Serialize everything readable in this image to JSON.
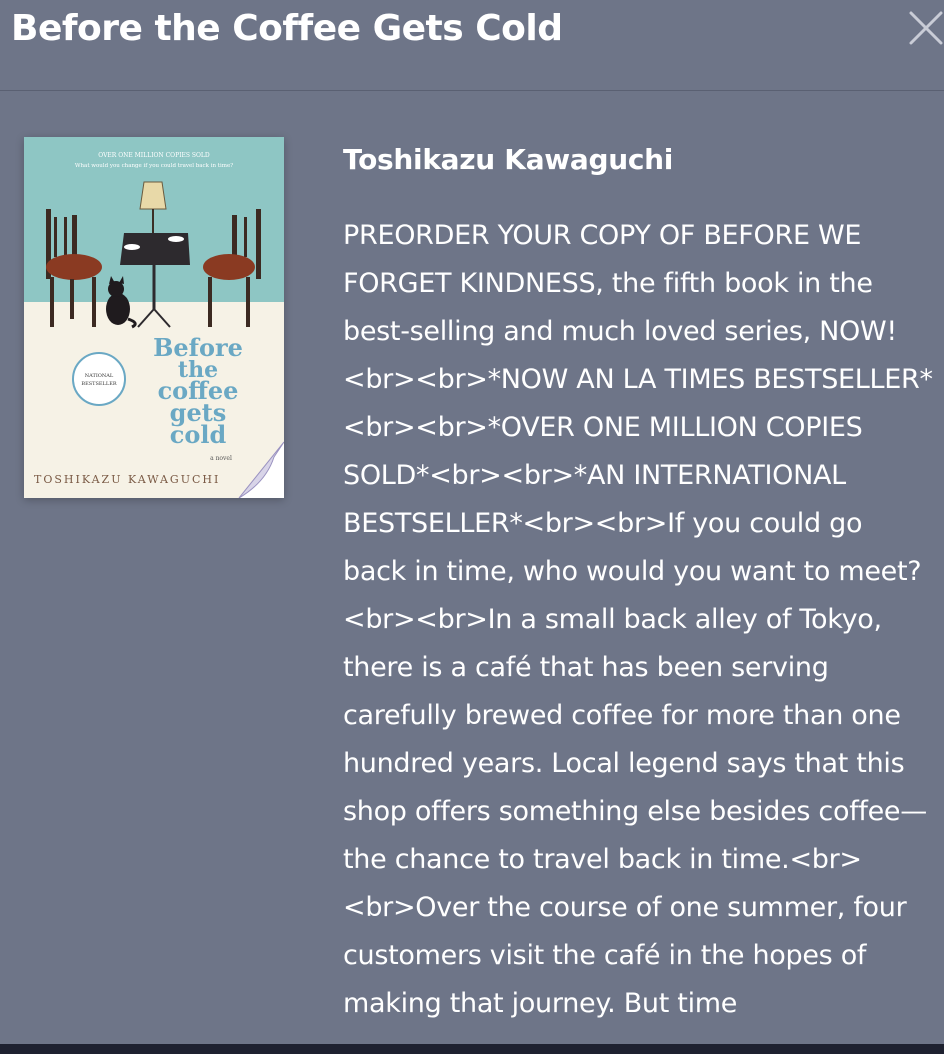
{
  "modal": {
    "title": "Before the Coffee Gets Cold",
    "close_icon": "close-icon",
    "author": "Toshikazu Kawaguchi",
    "description": "PREORDER YOUR COPY OF BEFORE WE FORGET KINDNESS, the fifth book in the best-selling and much loved series, NOW!<br><br>*NOW AN LA TIMES BESTSELLER*<br><br>*OVER ONE MILLION COPIES SOLD*<br><br>*AN INTERNATIONAL BESTSELLER*<br><br>If you could go back in time, who would you want to meet?<br><br>In a small back alley of Tokyo, there is a café that has been serving carefully brewed coffee for more than one hundred years. Local legend says that this shop offers something else besides coffee—the chance to travel back in time.<br><br>Over the course of one summer, four customers visit the café in the hopes of making that journey. But time"
  },
  "cover": {
    "top_banner": "OVER ONE MILLION COPIES SOLD",
    "tagline": "What would you change if you could travel back in time?",
    "badge_line1": "NATIONAL",
    "badge_line2": "BESTSELLER",
    "title_line1": "Before",
    "title_line2": "the",
    "title_line3": "coffee",
    "title_line4": "gets",
    "title_line5": "cold",
    "subtitle": "a novel",
    "author": "TOSHIKAZU KAWAGUCHI",
    "teal_color": "#8ec6c4",
    "title_color": "#6aa8c4"
  }
}
